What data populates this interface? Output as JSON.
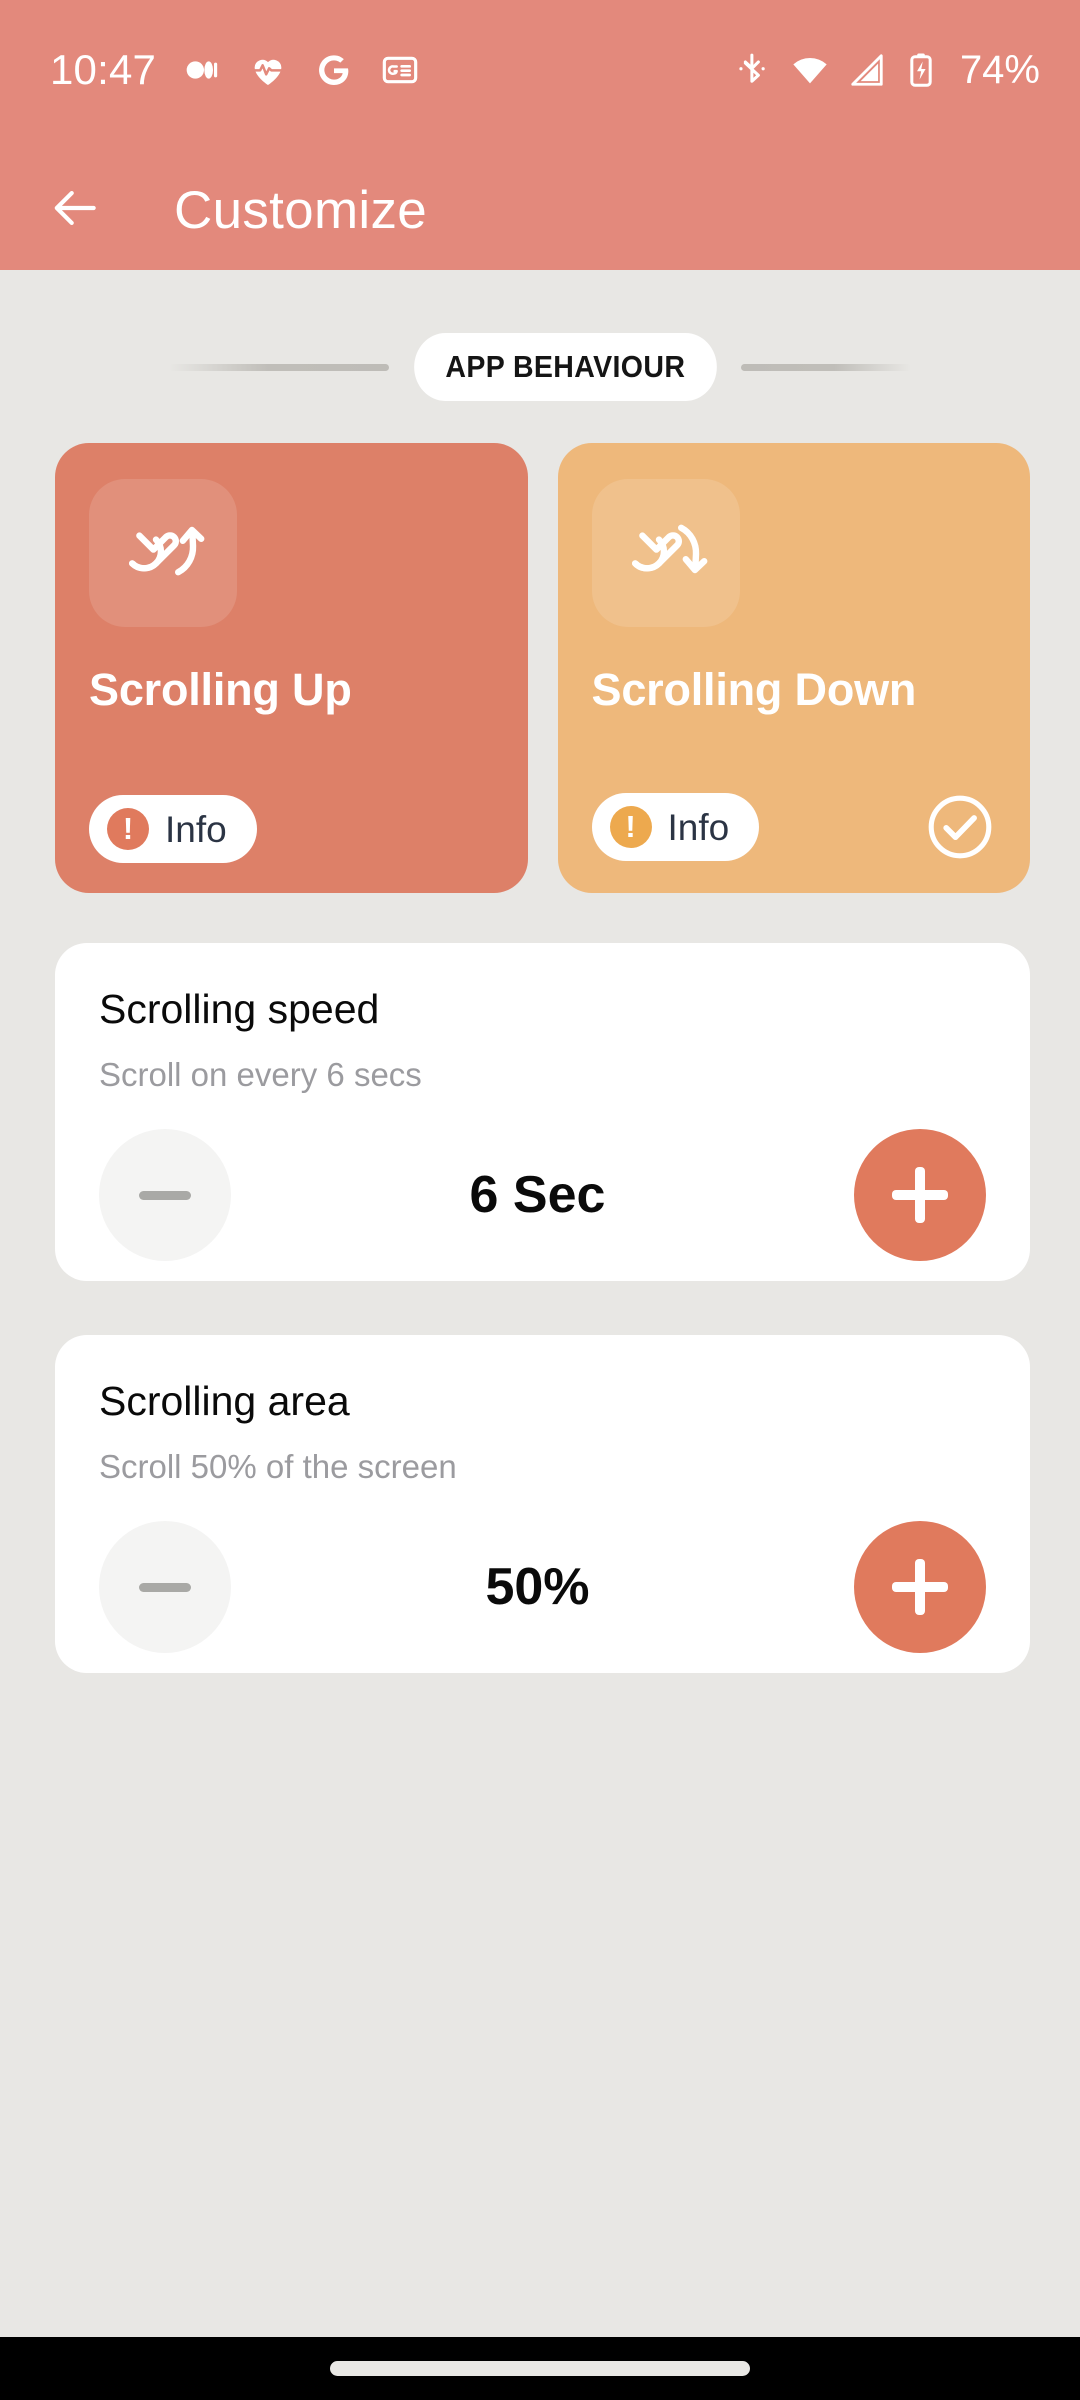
{
  "status_bar": {
    "time": "10:47",
    "battery_percent": "74%",
    "left_icons": [
      "camera-mic-icon",
      "heart-rate-icon",
      "google-icon",
      "google-news-icon"
    ],
    "right_icons": [
      "bluetooth-icon",
      "wifi-icon",
      "cellular-signal-icon",
      "battery-charging-icon"
    ]
  },
  "app_bar": {
    "back_icon": "back-arrow-icon",
    "title": "Customize",
    "background_color": "#e3897c"
  },
  "section": {
    "label": "APP BEHAVIOUR"
  },
  "modes": [
    {
      "id": "scrolling-up",
      "title": "Scrolling Up",
      "icon": "swipe-up-cursor-icon",
      "info_label": "Info",
      "info_icon": "exclamation-circle-icon",
      "selected": false,
      "background_color": "#dd8068"
    },
    {
      "id": "scrolling-down",
      "title": "Scrolling Down",
      "icon": "swipe-down-cursor-icon",
      "info_label": "Info",
      "info_icon": "exclamation-circle-icon",
      "selected": true,
      "selected_icon": "check-circle-icon",
      "background_color": "#eeb87b"
    }
  ],
  "settings": [
    {
      "id": "scrolling-speed",
      "title": "Scrolling speed",
      "subtitle": "Scroll on every 6 secs",
      "value": "6 Sec",
      "decrement_icon": "minus-icon",
      "increment_icon": "plus-icon",
      "decrement_enabled": false,
      "increment_enabled": true
    },
    {
      "id": "scrolling-area",
      "title": "Scrolling area",
      "subtitle": "Scroll 50% of the screen",
      "value": "50%",
      "decrement_icon": "minus-icon",
      "increment_icon": "plus-icon",
      "decrement_enabled": false,
      "increment_enabled": true
    }
  ],
  "nav_bar": {
    "gesture_pill": "home-gesture-pill"
  },
  "theme": {
    "accent": "#e07a5d",
    "header": "#e3897c",
    "page_background": "#e8e7e4",
    "card_background": "#ffffff",
    "info_text": "#2b3444",
    "muted_text": "#9b9b9f"
  }
}
